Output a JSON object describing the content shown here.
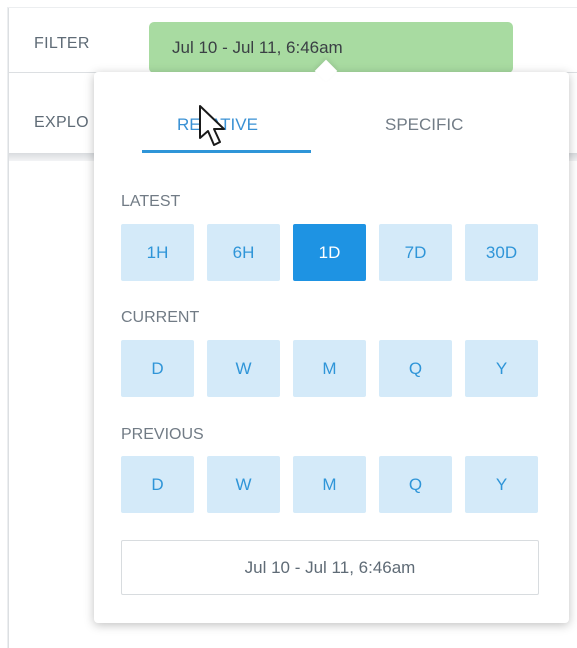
{
  "filter_label": "FILTER",
  "explore_label": "EXPLO",
  "date_pill": "Jul 10 - Jul 11, 6:46am",
  "tabs": {
    "relative": "RELATIVE",
    "specific": "SPECIFIC",
    "active": "relative"
  },
  "latest": {
    "label": "LATEST",
    "options": [
      "1H",
      "6H",
      "1D",
      "7D",
      "30D"
    ],
    "selected": "1D"
  },
  "current": {
    "label": "CURRENT",
    "options": [
      "D",
      "W",
      "M",
      "Q",
      "Y"
    ]
  },
  "previous": {
    "label": "PREVIOUS",
    "options": [
      "D",
      "W",
      "M",
      "Q",
      "Y"
    ]
  },
  "range_display": "Jul 10 - Jul 11, 6:46am",
  "colors": {
    "pill": "#a8dba1",
    "accent": "#1e93e3",
    "chip": "#d4eaf9"
  },
  "icons": {
    "cursor": "mouse-pointer-icon"
  }
}
